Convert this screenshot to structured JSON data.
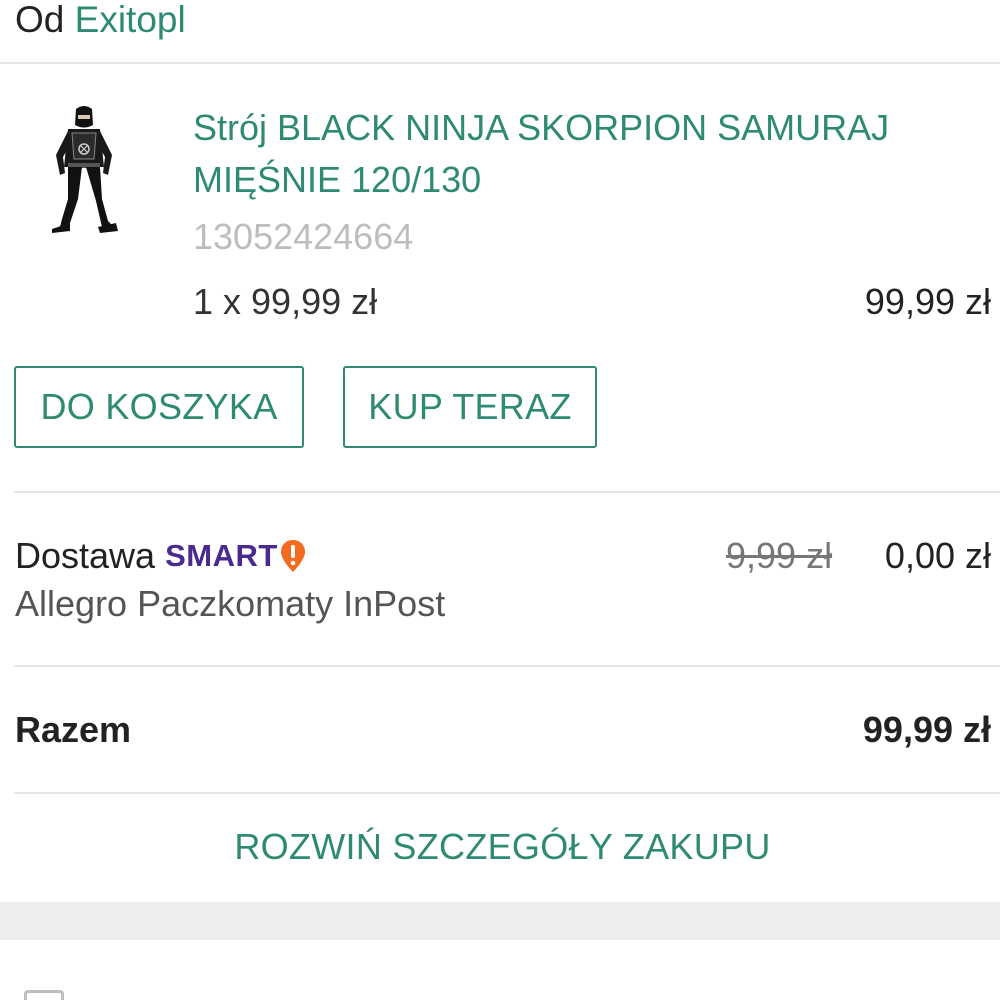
{
  "seller": {
    "prefix": "Od",
    "name": "Exitopl"
  },
  "product": {
    "image_icon": "ninja-costume-image",
    "title": "Strój BLACK NINJA SKORPION SAMURAJ MIĘŚNIE 120/130",
    "offer_id": "13052424664",
    "quantity_price": "1 x 99,99 zł",
    "line_total": "99,99 zł"
  },
  "actions": {
    "add_to_cart": "DO KOSZYKA",
    "buy_now": "KUP TERAZ"
  },
  "delivery": {
    "label": "Dostawa",
    "smart_badge": "SMART",
    "smart_icon": "smart-exclamation-icon",
    "method": "Allegro Paczkomaty InPost",
    "old_price": "9,99 zł",
    "new_price": "0,00 zł"
  },
  "summary": {
    "total_label": "Razem",
    "total_value": "99,99 zł"
  },
  "expand_details": "ROZWIŃ SZCZEGÓŁY ZAKUPU",
  "colors": {
    "accent": "#2f8a73",
    "smart_purple": "#4b2a8f",
    "smart_orange": "#f26b21"
  }
}
